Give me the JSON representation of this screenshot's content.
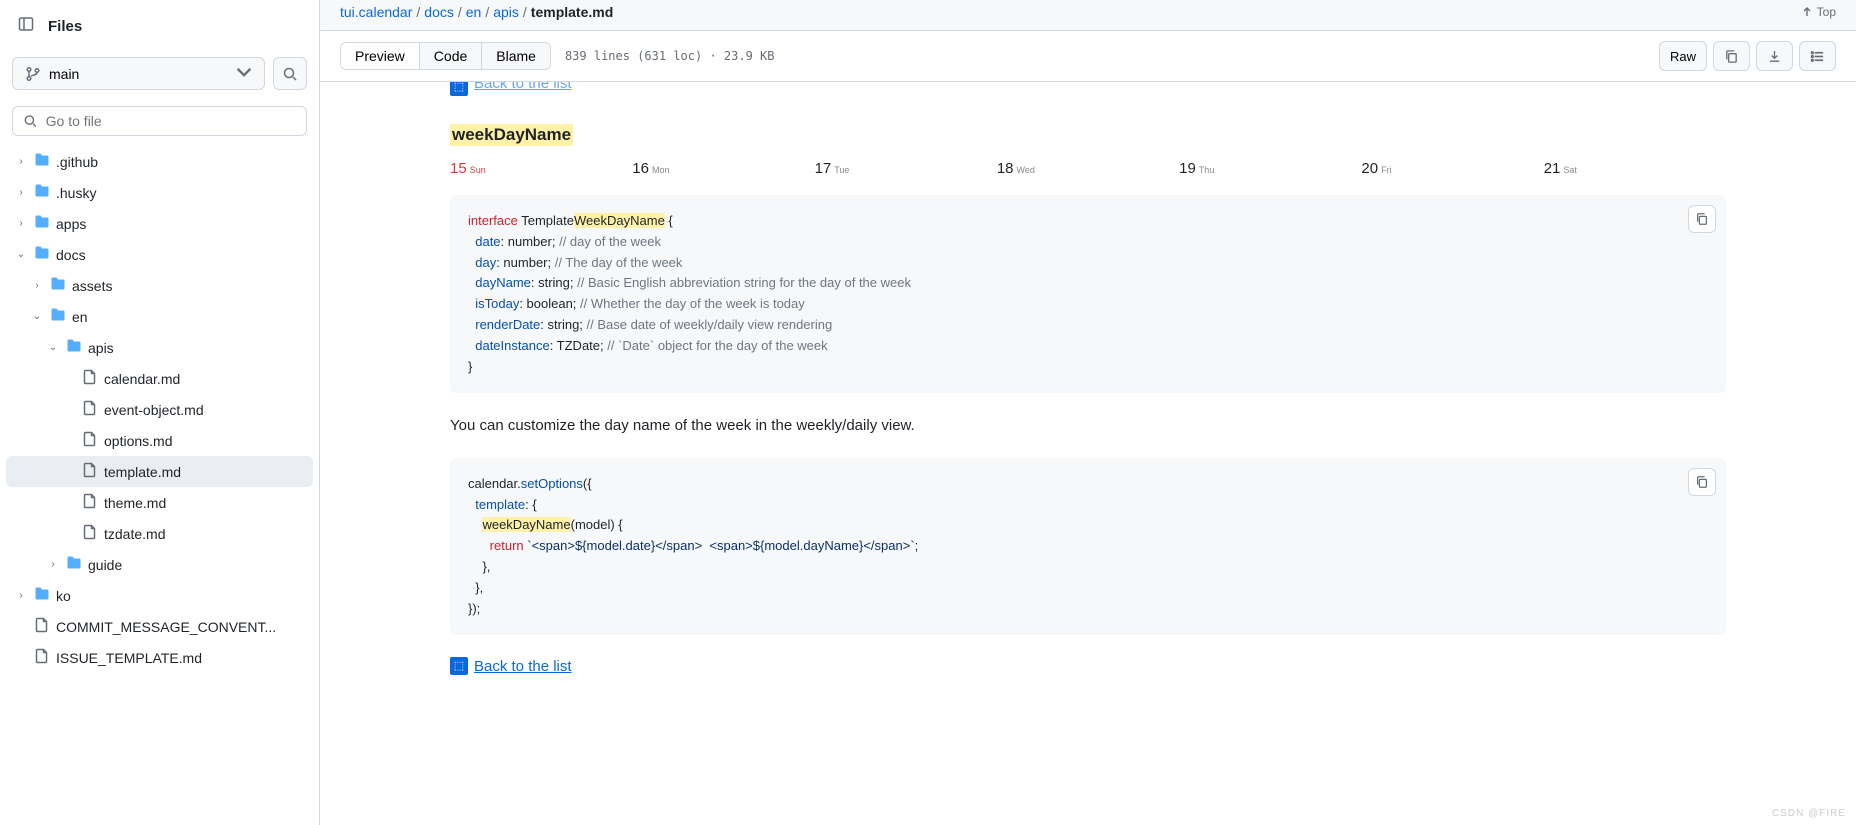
{
  "sidebar": {
    "title": "Files",
    "branch": "main",
    "gotofile_placeholder": "Go to file",
    "tree": [
      {
        "type": "folder",
        "name": ".github",
        "indent": 0,
        "chev": "right"
      },
      {
        "type": "folder",
        "name": ".husky",
        "indent": 0,
        "chev": "right"
      },
      {
        "type": "folder",
        "name": "apps",
        "indent": 0,
        "chev": "right"
      },
      {
        "type": "folder",
        "name": "docs",
        "indent": 0,
        "chev": "down"
      },
      {
        "type": "folder",
        "name": "assets",
        "indent": 1,
        "chev": "right"
      },
      {
        "type": "folder",
        "name": "en",
        "indent": 1,
        "chev": "down"
      },
      {
        "type": "folder",
        "name": "apis",
        "indent": 2,
        "chev": "down"
      },
      {
        "type": "file",
        "name": "calendar.md",
        "indent": 3
      },
      {
        "type": "file",
        "name": "event-object.md",
        "indent": 3
      },
      {
        "type": "file",
        "name": "options.md",
        "indent": 3
      },
      {
        "type": "file",
        "name": "template.md",
        "indent": 3,
        "selected": true
      },
      {
        "type": "file",
        "name": "theme.md",
        "indent": 3
      },
      {
        "type": "file",
        "name": "tzdate.md",
        "indent": 3
      },
      {
        "type": "folder",
        "name": "guide",
        "indent": 2,
        "chev": "right"
      },
      {
        "type": "folder",
        "name": "ko",
        "indent": 0,
        "chev": "right"
      },
      {
        "type": "file",
        "name": "COMMIT_MESSAGE_CONVENT...",
        "indent": 0
      },
      {
        "type": "file",
        "name": "ISSUE_TEMPLATE.md",
        "indent": 0
      }
    ]
  },
  "breadcrumbs": {
    "parts": [
      "tui.calendar",
      "docs",
      "en",
      "apis"
    ],
    "current": "template.md",
    "top_label": "Top"
  },
  "toolbar": {
    "tabs": {
      "preview": "Preview",
      "code": "Code",
      "blame": "Blame"
    },
    "info": "839 lines (631 loc) · 23.9 KB",
    "raw": "Raw"
  },
  "doc": {
    "back_label": "Back to the list",
    "heading": "weekDayName",
    "week": [
      {
        "num": "15",
        "day": "Sun",
        "cls": "sun"
      },
      {
        "num": "16",
        "day": "Mon"
      },
      {
        "num": "17",
        "day": "Tue"
      },
      {
        "num": "18",
        "day": "Wed"
      },
      {
        "num": "19",
        "day": "Thu"
      },
      {
        "num": "20",
        "day": "Fri"
      },
      {
        "num": "21",
        "day": "Sat"
      }
    ],
    "code1": {
      "kw_interface": "interface",
      "type_prefix": " Template",
      "type_hl": "WeekDayName",
      "brace": " {",
      "rows": [
        {
          "key": "date",
          "rest": ": number; ",
          "cm": "// day of the week"
        },
        {
          "key": "day",
          "rest": ": number; ",
          "cm": "// The day of the week"
        },
        {
          "key": "dayName",
          "rest": ": string; ",
          "cm": "// Basic English abbreviation string for the day of the week"
        },
        {
          "key": "isToday",
          "rest": ": boolean; ",
          "cm": "// Whether the day of the week is today"
        },
        {
          "key": "renderDate",
          "rest": ": string; ",
          "cm": "// Base date of weekly/daily view rendering"
        },
        {
          "key": "dateInstance",
          "rest": ": TZDate; ",
          "cm": "// `Date` object for the day of the week"
        }
      ],
      "close": "}"
    },
    "prose": "You can customize the day name of the week in the weekly/daily view.",
    "code2": {
      "l1_pre": "calendar.",
      "l1_fn": "setOptions",
      "l1_post": "({",
      "l2_key": "template",
      "l2_post": ": {",
      "l3_fn": "weekDayName",
      "l3_post": "(model) {",
      "l4_kw": "return",
      "l4_str": " `<span>${model.date}</span>&nbsp;&nbsp;<span>${model.dayName}</span>`",
      "l4_end": ";",
      "l5": "    },",
      "l6": "  },",
      "l7": "});"
    }
  },
  "watermark": "CSDN @FIRE"
}
